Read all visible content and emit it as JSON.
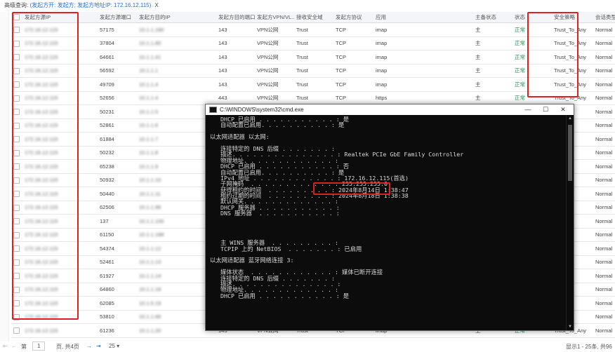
{
  "search": {
    "prefix": "高级查询:",
    "query": "(发起方开: 发起方; 发起方地址IP: 172.16.12.115)",
    "close": "X"
  },
  "table": {
    "columns": [
      "发起方源IP",
      "发起方源端口",
      "发起方目的IP",
      "发起方目的端口",
      "发起方VPN/VL...",
      "接收安全域",
      "发起方协议",
      "应用",
      "主备状态",
      "状态",
      "安全策略",
      "会话类型"
    ],
    "rows": [
      [
        "172.16.12.115",
        "57175",
        "10.1.1.180",
        "143",
        "VPN公网",
        "Trust",
        "TCP",
        "imap",
        "主",
        "正常",
        "Trust_To_Any",
        "Normal"
      ],
      [
        "172.16.12.115",
        "37804",
        "10.1.1.80",
        "143",
        "VPN公网",
        "Trust",
        "TCP",
        "imap",
        "主",
        "正常",
        "Trust_To_Any",
        "Normal"
      ],
      [
        "172.16.12.115",
        "64661",
        "10.1.1.41",
        "143",
        "VPN公网",
        "Trust",
        "TCP",
        "imap",
        "主",
        "正常",
        "Trust_To_Any",
        "Normal"
      ],
      [
        "172.16.12.115",
        "56592",
        "10.1.1.1",
        "143",
        "VPN公网",
        "Trust",
        "TCP",
        "imap",
        "主",
        "正常",
        "Trust_To_Any",
        "Normal"
      ],
      [
        "172.16.12.115",
        "49709",
        "10.1.1.4",
        "143",
        "VPN公网",
        "Trust",
        "TCP",
        "imap",
        "主",
        "正常",
        "Trust_To_Any",
        "Normal"
      ],
      [
        "172.16.12.115",
        "52656",
        "10.1.1.4",
        "443",
        "VPN公网",
        "Trust",
        "TCP",
        "https",
        "主",
        "正常",
        "Trust_To_Any",
        "Normal"
      ],
      [
        "172.16.12.115",
        "50231",
        "10.1.1.5",
        "",
        "",
        "",
        "",
        "",
        "",
        "",
        "",
        "Normal"
      ],
      [
        "172.16.12.115",
        "52861",
        "10.1.1.6",
        "",
        "",
        "",
        "",
        "",
        "",
        "",
        "",
        "Normal"
      ],
      [
        "172.16.12.115",
        "61884",
        "10.1.1.7",
        "",
        "",
        "",
        "",
        "",
        "",
        "",
        "",
        "Normal"
      ],
      [
        "172.16.12.115",
        "50232",
        "10.1.1.8",
        "",
        "",
        "",
        "",
        "",
        "",
        "",
        "",
        "Normal"
      ],
      [
        "172.16.12.115",
        "65238",
        "10.1.1.9",
        "",
        "",
        "",
        "",
        "",
        "",
        "",
        "",
        "Normal"
      ],
      [
        "172.16.12.115",
        "50932",
        "10.1.1.10",
        "",
        "",
        "",
        "",
        "",
        "",
        "",
        "",
        "Normal"
      ],
      [
        "172.16.12.115",
        "50440",
        "10.1.1.11",
        "",
        "",
        "",
        "",
        "",
        "",
        "",
        "",
        "Normal"
      ],
      [
        "172.16.12.115",
        "62506",
        "10.1.1.96",
        "",
        "",
        "",
        "",
        "",
        "",
        "",
        "",
        "Normal"
      ],
      [
        "172.16.12.115",
        "137",
        "10.1.1.100",
        "",
        "",
        "",
        "",
        "",
        "",
        "",
        "",
        "Normal"
      ],
      [
        "172.16.12.115",
        "61150",
        "10.1.1.188",
        "",
        "",
        "",
        "",
        "",
        "",
        "",
        "",
        "Normal"
      ],
      [
        "172.16.12.115",
        "54374",
        "10.1.1.12",
        "",
        "",
        "",
        "",
        "",
        "",
        "",
        "",
        "Normal"
      ],
      [
        "172.16.12.115",
        "52461",
        "10.1.1.13",
        "",
        "",
        "",
        "",
        "",
        "",
        "",
        "",
        "Normal"
      ],
      [
        "172.16.12.115",
        "61927",
        "10.1.1.14",
        "",
        "",
        "",
        "",
        "",
        "",
        "",
        "",
        "Normal"
      ],
      [
        "172.16.12.115",
        "64860",
        "10.1.1.18",
        "",
        "",
        "",
        "",
        "",
        "",
        "",
        "",
        "Normal"
      ],
      [
        "172.16.12.115",
        "62085",
        "10.1.5.19",
        "",
        "",
        "",
        "",
        "",
        "",
        "",
        "",
        "Normal"
      ],
      [
        "172.16.12.115",
        "53810",
        "10.1.1.66",
        "",
        "",
        "",
        "",
        "",
        "",
        "",
        "",
        "Normal"
      ],
      [
        "172.16.12.115",
        "61236",
        "10.1.1.20",
        "143",
        "VPN公网",
        "Trust",
        "TCP",
        "imap",
        "主",
        "正常",
        "Trust_To_Any",
        "Normal"
      ]
    ]
  },
  "cmd": {
    "title": "C:\\WINDOWS\\system32\\cmd.exe",
    "minimize": "—",
    "maximize": "☐",
    "close": "✕",
    "lines": [
      "   DHCP 已启用 . . . . . . . . . . . : 是",
      "   自动配置已启用. . . . . . . . . . : 是",
      "",
      "以太网适配器 以太网:",
      "",
      "   连接特定的 DNS 后缀 . . . . . . . :",
      "   描述. . . . . . . . . . . . . . . : Realtek PCIe GbE Family Controller",
      "   物理地址. . . . . . . . . . . . . : ",
      "   DHCP 已启用 . . . . . . . . . . . : 否",
      "   自动配置已启用. . . . . . . . . . : 是",
      "   IPv4 地址 . . . . . . . . . . . . : 172.16.12.115(首选)",
      "   子网掩码  . . . . . . . . . . . . : 255.255.255.0",
      "   获得租约的时间  . . . . . . . . . : 2024年8月14日 1:38:47",
      "   租约过期的时间  . . . . . . . . . : 2024年8月18日 1:38:38",
      "   默认网关. . . . . . . . . . . . . : ",
      "   DHCP 服务器 . . . . . . . . . . . : ",
      "   DNS 服务器  . . . . . . . . . . . : ",
      "",
      "",
      "",
      "",
      "   主 WINS 服务器  . . . . . . . . . : ",
      "   TCPIP 上的 NetBIOS  . . . . . . . : 已启用",
      "",
      "以太网适配器 蓝牙网络连接 3:",
      "",
      "   媒体状态  . . . . . . . . . . . . : 媒体已断开连接",
      "   连接特定的 DNS 后缀 . . . . . . . :",
      "   描述. . . . . . . . . . . . . . . : ",
      "   物理地址. . . . . . . . . . . . . : ",
      "   DHCP 已启用 . . . . . . . . . . . : 是"
    ]
  },
  "pager": {
    "first": "⇤",
    "prev": "←",
    "page_label": "第",
    "page": "1",
    "page_suffix": "页, 共4页",
    "next": "→",
    "last": "⇥",
    "page_size": "25 ▾",
    "summary": "显示1 - 25条, 共96"
  },
  "colors": {
    "highlight_box": "#e02020",
    "link": "#1f6fd8",
    "status_ok": "#2e8b57"
  }
}
